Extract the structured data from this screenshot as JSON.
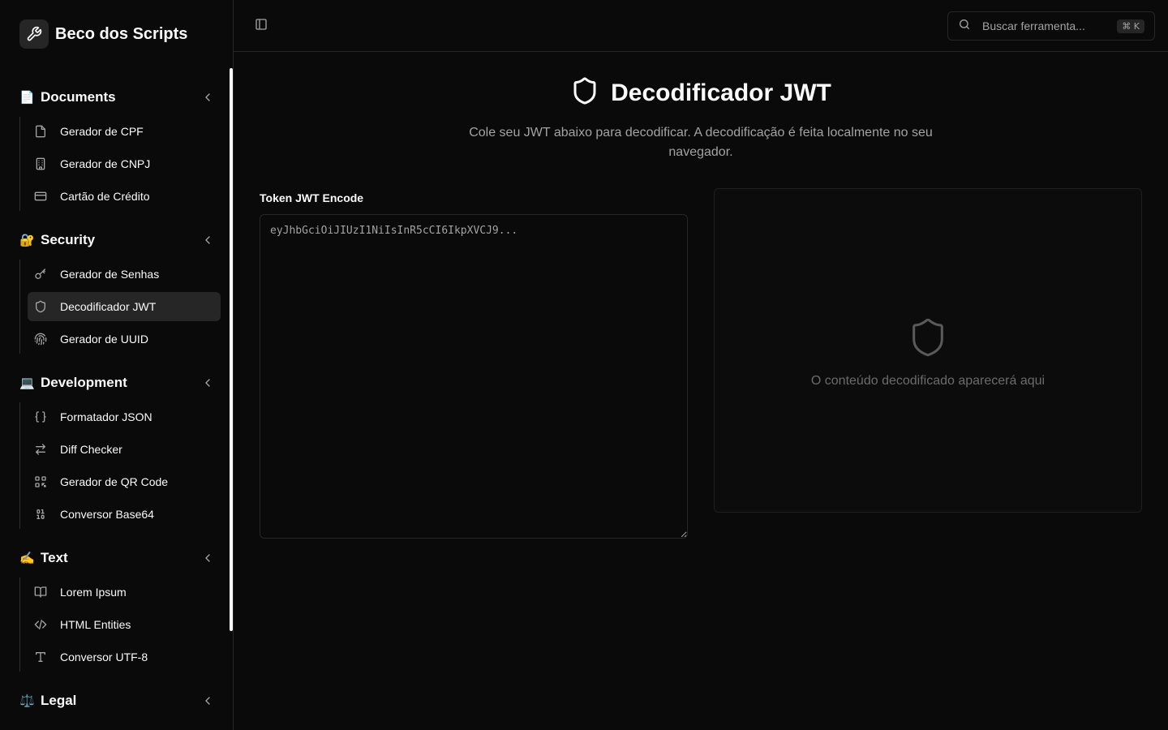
{
  "app": {
    "name": "Beco dos Scripts"
  },
  "search": {
    "placeholder": "Buscar ferramenta...",
    "shortcut": "⌘ K"
  },
  "sidebar": {
    "sections": [
      {
        "emoji": "📄",
        "title": "Documents",
        "items": [
          {
            "label": "Gerador de CPF",
            "icon": "file-icon"
          },
          {
            "label": "Gerador de CNPJ",
            "icon": "building-icon"
          },
          {
            "label": "Cartão de Crédito",
            "icon": "credit-card-icon"
          }
        ]
      },
      {
        "emoji": "🔐",
        "title": "Security",
        "items": [
          {
            "label": "Gerador de Senhas",
            "icon": "key-icon"
          },
          {
            "label": "Decodificador JWT",
            "icon": "shield-icon",
            "active": true
          },
          {
            "label": "Gerador de UUID",
            "icon": "fingerprint-icon"
          }
        ]
      },
      {
        "emoji": "💻",
        "title": "Development",
        "items": [
          {
            "label": "Formatador JSON",
            "icon": "braces-icon"
          },
          {
            "label": "Diff Checker",
            "icon": "arrows-left-right-icon"
          },
          {
            "label": "Gerador de QR Code",
            "icon": "qr-code-icon"
          },
          {
            "label": "Conversor Base64",
            "icon": "binary-icon"
          }
        ]
      },
      {
        "emoji": "✍️",
        "title": "Text",
        "items": [
          {
            "label": "Lorem Ipsum",
            "icon": "book-open-icon"
          },
          {
            "label": "HTML Entities",
            "icon": "code-icon"
          },
          {
            "label": "Conversor UTF-8",
            "icon": "type-icon"
          }
        ]
      },
      {
        "emoji": "⚖️",
        "title": "Legal",
        "items": []
      }
    ]
  },
  "main": {
    "title": "Decodificador JWT",
    "description": "Cole seu JWT abaixo para decodificar. A decodificação é feita localmente no seu navegador.",
    "input_label": "Token JWT Encode",
    "input_placeholder": "eyJhbGciOiJIUzI1NiIsInR5cCI6IkpXVCJ9...",
    "output_placeholder": "O conteúdo decodificado aparecerá aqui"
  },
  "colors": {
    "background": "#0a0a0a",
    "border": "#262626",
    "muted_text": "#a3a3a3"
  }
}
